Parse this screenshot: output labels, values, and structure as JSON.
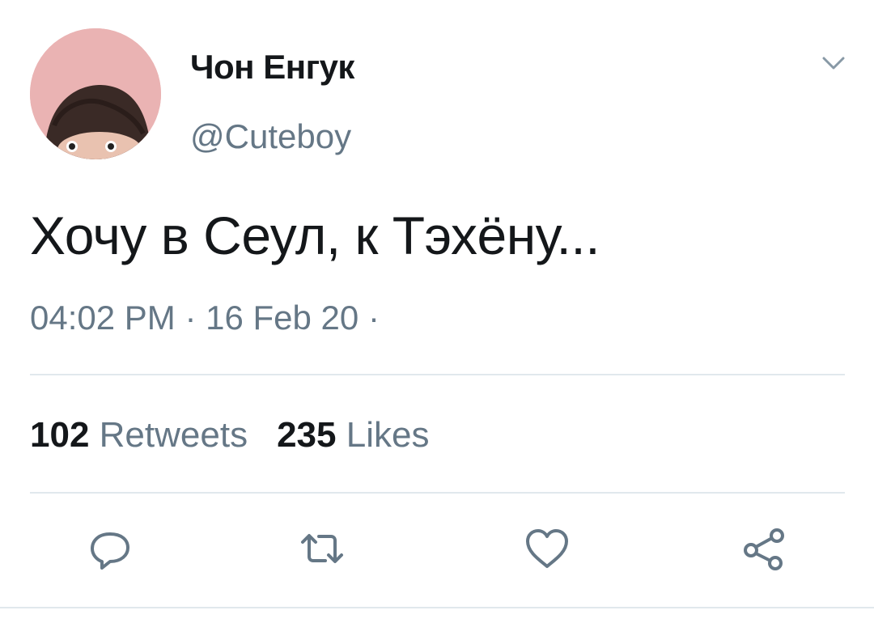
{
  "author": {
    "display_name": "Чон Енгук",
    "handle": "@Cuteboy"
  },
  "tweet": {
    "text": "Хочу в Сеул, к Тэхёну...",
    "time": "04:02 PM",
    "date": "16 Feb 20",
    "separator": "·"
  },
  "stats": {
    "retweets_count": "102",
    "retweets_label": "Retweets",
    "likes_count": "235",
    "likes_label": "Likes"
  },
  "actions": {
    "reply_icon": "reply-icon",
    "retweet_icon": "retweet-icon",
    "like_icon": "heart-icon",
    "share_icon": "share-icon"
  },
  "colors": {
    "text": "#14171a",
    "secondary": "#657786",
    "divider": "#e1e8ed",
    "avatar_bg": "#eab3b3"
  }
}
